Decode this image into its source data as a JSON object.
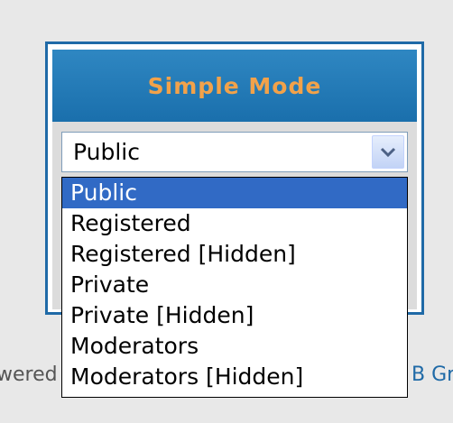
{
  "panel": {
    "title": "Simple Mode"
  },
  "select": {
    "current_value": "Public",
    "arrow_icon": "chevron-down-icon"
  },
  "dropdown": {
    "options": [
      {
        "label": "Public",
        "selected": true
      },
      {
        "label": "Registered",
        "selected": false
      },
      {
        "label": "Registered [Hidden]",
        "selected": false
      },
      {
        "label": "Private",
        "selected": false
      },
      {
        "label": "Private [Hidden]",
        "selected": false
      },
      {
        "label": "Moderators",
        "selected": false
      },
      {
        "label": "Moderators [Hidden]",
        "selected": false
      }
    ]
  },
  "footer": {
    "left_fragment": "wered",
    "right_fragment": "B Gr"
  },
  "colors": {
    "panel_border": "#1f6aa7",
    "title_accent": "#f2a24a",
    "selection_highlight": "#316ac5"
  }
}
